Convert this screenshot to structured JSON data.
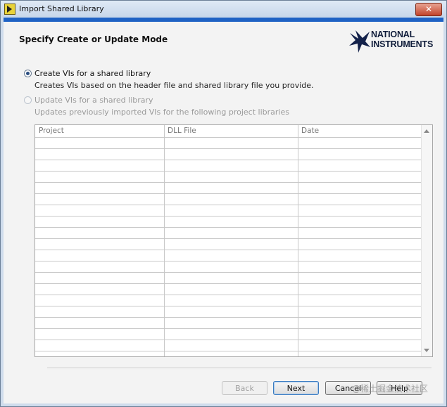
{
  "window": {
    "title": "Import Shared Library",
    "close_glyph": "✕"
  },
  "header": {
    "title": "Specify Create or Update Mode",
    "logo": {
      "line1": "NATIONAL",
      "line2": "INSTRUMENTS"
    }
  },
  "options": [
    {
      "label": "Create VIs for a shared library",
      "description": "Creates VIs based on the header file and shared library file you provide.",
      "selected": true,
      "enabled": true
    },
    {
      "label": "Update VIs for a shared library",
      "description": "Updates previously imported VIs for the following project libraries",
      "selected": false,
      "enabled": false
    }
  ],
  "table": {
    "columns": [
      "Project",
      "DLL File",
      "Date"
    ],
    "rows": []
  },
  "buttons": {
    "back": "Back",
    "next": "Next",
    "cancel": "Cancel",
    "help": "Help"
  },
  "watermark": "@稀土掘金技术社区"
}
